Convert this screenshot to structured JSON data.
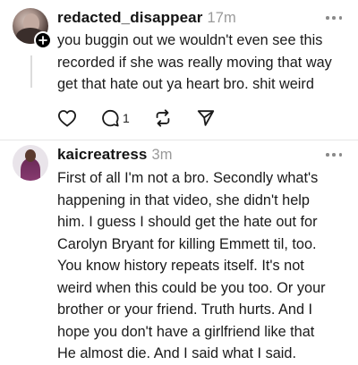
{
  "comments": [
    {
      "username": "redacted_disappear",
      "time": "17m",
      "text": "you buggin out we wouldn't even see this\nrecorded if she was really moving that way\nget that hate out ya heart bro. shit weird",
      "actions": {
        "reply_count": "1"
      }
    },
    {
      "username": "kaicreatress",
      "time": "3m",
      "text": "First of all I'm not a bro. Secondly  what's\nhappening in that video,  she didn't help\nhim. I guess I should get the hate out for\nCarolyn Bryant for killing Emmett til, too.\nYou know history repeats itself. It's not\nweird when this could be you too.  Or your\nbrother or your friend.  Truth hurts.  And I\nhope you don't have a girlfriend like that\nHe almost die. And I said what I said."
    }
  ],
  "icons": {
    "like": "heart-icon",
    "reply": "comment-icon",
    "repost": "repost-icon",
    "share": "send-icon",
    "more": "more-icon",
    "follow": "plus-icon"
  }
}
